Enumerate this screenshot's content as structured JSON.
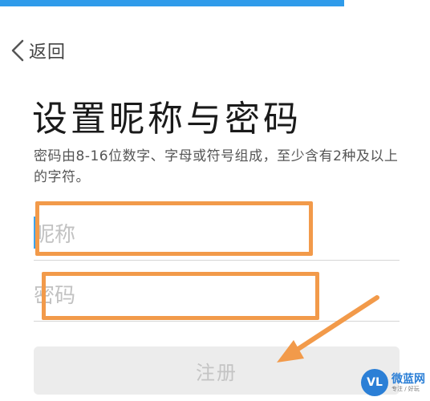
{
  "header": {
    "back_label": "返回",
    "back_icon": "chevron-left-icon",
    "progress_fraction": 0.8,
    "progress_color": "#2f9bea"
  },
  "main": {
    "title": "设置昵称与密码",
    "hint": "密码由8-16位数字、字母或符号组成，至少含有2种及以上的字符。",
    "nickname_placeholder": "昵称",
    "nickname_value": "",
    "password_placeholder": "密码",
    "password_value": "",
    "register_label": "注册"
  },
  "annotations": {
    "highlight_color": "#f29a4a"
  },
  "watermark": {
    "logo_text": "VL",
    "name": "微蓝网",
    "sub": "专注 / 好玩"
  }
}
